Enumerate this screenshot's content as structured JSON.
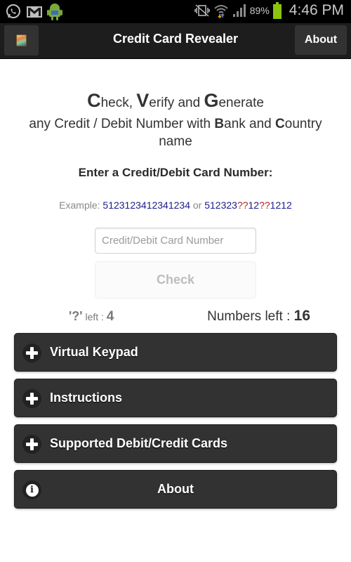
{
  "status_bar": {
    "notification_icons": [
      "whatsapp-icon",
      "gmail-icon",
      "android-icon"
    ],
    "system_icons": [
      "vibrate-mute-icon",
      "wifi-icon",
      "signal-icon"
    ],
    "battery_percent": "89%",
    "battery_color": "#8bc40c",
    "time": "4:46 PM"
  },
  "action_bar": {
    "title": "Credit Card Revealer",
    "about_label": "About"
  },
  "headline": {
    "c": "C",
    "heck": "heck, ",
    "v": "V",
    "erify": "erify and ",
    "g": "G",
    "enerate": "enerate"
  },
  "subline": {
    "part1": "any Credit / Debit Number with ",
    "b": "B",
    "ank": "ank and ",
    "c": "C",
    "ountry": "ountry name"
  },
  "enter_label": "Enter a Credit/Debit Card Number:",
  "example": {
    "prefix": "Example: ",
    "number1": "5123123412341234",
    "or": " or ",
    "n2a": "512323",
    "q1": "??",
    "n2b": "12",
    "q2": "??",
    "n2c": "1212"
  },
  "card_input": {
    "value": "",
    "placeholder": "Credit/Debit Card Number"
  },
  "check_button": "Check",
  "counters": {
    "q_symbol": "'?'",
    "q_label": " left : ",
    "q_value": "4",
    "numbers_label": "Numbers left : ",
    "numbers_value": "16"
  },
  "sections": [
    {
      "label": "Virtual Keypad",
      "icon": "plus-icon"
    },
    {
      "label": "Instructions",
      "icon": "plus-icon"
    },
    {
      "label": "Supported Debit/Credit Cards",
      "icon": "plus-icon"
    },
    {
      "label": "About",
      "icon": "info-icon"
    }
  ],
  "colors": {
    "example_number": "#1b1b8c",
    "example_wildcard": "#b42020",
    "section_bg": "#323232"
  }
}
